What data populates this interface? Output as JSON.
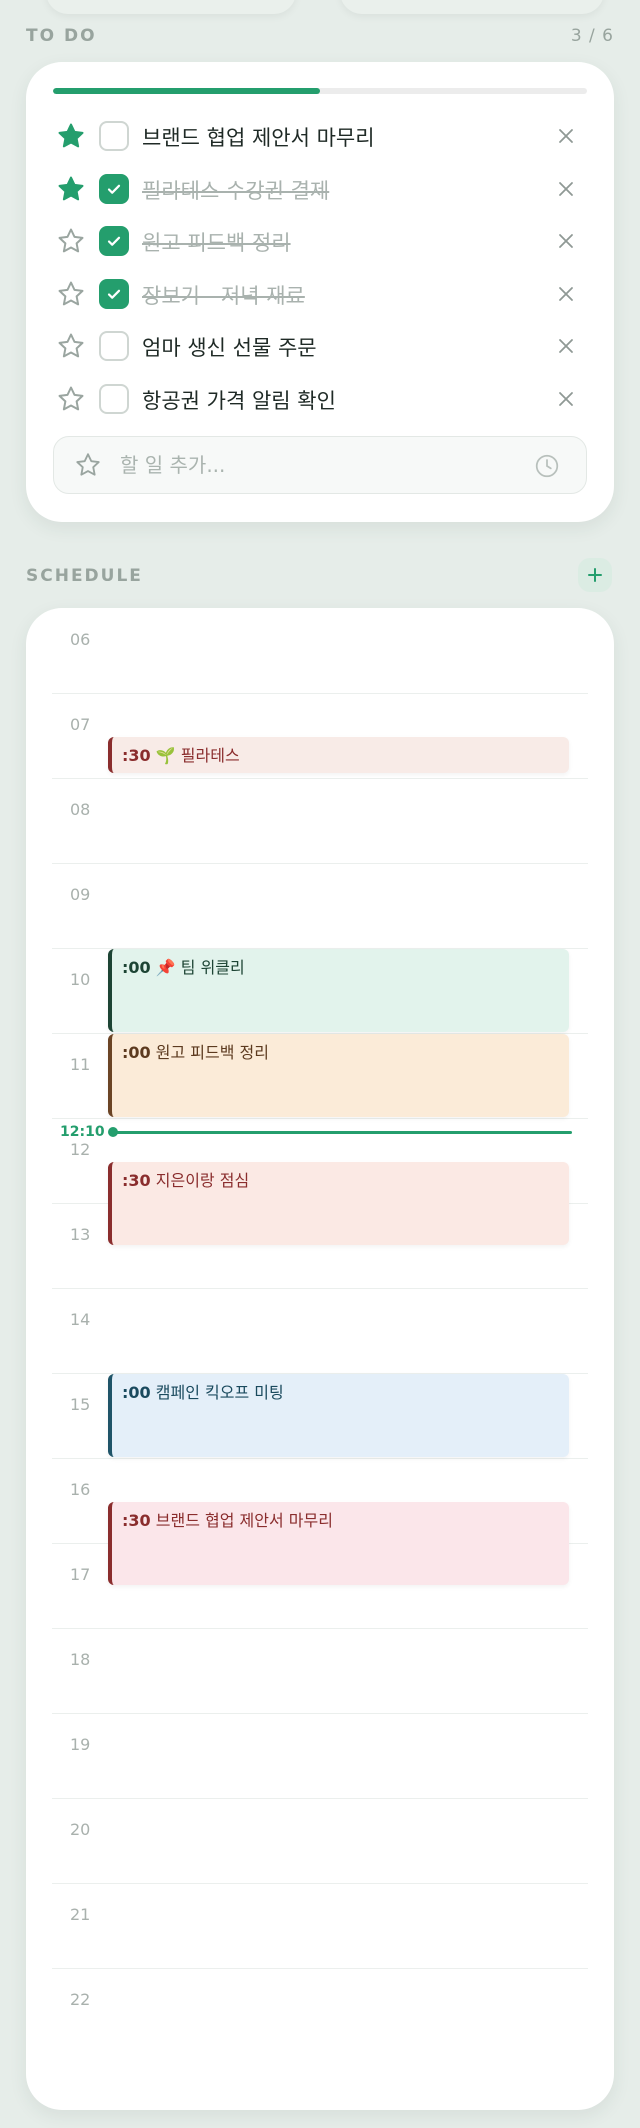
{
  "todo": {
    "label": "TO DO",
    "count": "3 / 6",
    "progress": 0.5,
    "items": [
      {
        "text": "브랜드 협업 제안서 마무리",
        "starred": true,
        "done": false
      },
      {
        "text": "필라테스 수강권 결제",
        "starred": true,
        "done": true
      },
      {
        "text": "원고 피드백 정리",
        "starred": false,
        "done": true
      },
      {
        "text": "장보기 - 저녁 재료",
        "starred": false,
        "done": true
      },
      {
        "text": "엄마 생신 선물 주문",
        "starred": false,
        "done": false
      },
      {
        "text": "항공권 가격 알림 확인",
        "starred": false,
        "done": false
      }
    ],
    "add_placeholder": "할 일 추가..."
  },
  "schedule": {
    "label": "SCHEDULE",
    "hours": [
      "06",
      "07",
      "08",
      "09",
      "10",
      "11",
      "12",
      "13",
      "14",
      "15",
      "16",
      "17",
      "18",
      "19",
      "20",
      "21",
      "22"
    ],
    "now": "12:10",
    "events": [
      {
        "time": ":30",
        "emoji": "🌱",
        "title": "필라테스",
        "style": "pink"
      },
      {
        "time": ":00",
        "emoji": "📌",
        "title": "팀 위클리",
        "style": "mint"
      },
      {
        "time": ":00",
        "emoji": "",
        "title": "원고 피드백 정리",
        "style": "peach"
      },
      {
        "time": ":30",
        "emoji": "",
        "title": "지은이랑 점심",
        "style": "salmon"
      },
      {
        "time": ":00",
        "emoji": "",
        "title": "캠페인 킥오프 미팅",
        "style": "blue"
      },
      {
        "time": ":30",
        "emoji": "",
        "title": "브랜드 협업 제안서 마무리",
        "style": "rose"
      }
    ]
  },
  "colors": {
    "accent": "#249e6d",
    "background": "#e6ede9"
  },
  "icons": {
    "star_filled": "star-icon",
    "star_outline": "star-outline-icon",
    "check": "check-icon",
    "delete": "close-icon",
    "clock": "clock-icon",
    "add": "plus-icon"
  }
}
